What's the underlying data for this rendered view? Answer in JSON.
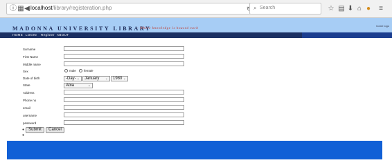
{
  "browser": {
    "url_host": "localhost",
    "url_path": "/library/registeration.php",
    "search_placeholder": "Search"
  },
  "header": {
    "title": "MADONNA UNIVERSITY LIBRARY",
    "tagline": "- Where knowledge is housed each",
    "home_login": "home logo"
  },
  "nav": {
    "items": [
      "HOME",
      "LOGIN",
      "Register",
      "ABOUT"
    ]
  },
  "form": {
    "fields": [
      {
        "label": "Surname",
        "value": ""
      },
      {
        "label": "First Name",
        "value": ""
      },
      {
        "label": "Middle name",
        "value": ""
      },
      {
        "label": "Sex"
      },
      {
        "label": "Date of birth"
      },
      {
        "label": "State"
      },
      {
        "label": "Address",
        "value": ""
      },
      {
        "label": "Phone no",
        "value": ""
      },
      {
        "label": "email",
        "value": ""
      },
      {
        "label": "username",
        "value": ""
      },
      {
        "label": "password",
        "value": ""
      }
    ],
    "sex_options": {
      "male": "male",
      "female": "female"
    },
    "dob": {
      "day": "-Day-",
      "month": "January",
      "year": "1980"
    },
    "state": "Abia",
    "submit_label": "Submit",
    "cancel_label": "Cancel"
  },
  "colors": {
    "header_bg": "#a7cdf5",
    "nav_bg": "#1a2f62",
    "footer_bg": "#1160d6",
    "title_color": "#1d2b58",
    "tagline_color": "#c0392b"
  }
}
